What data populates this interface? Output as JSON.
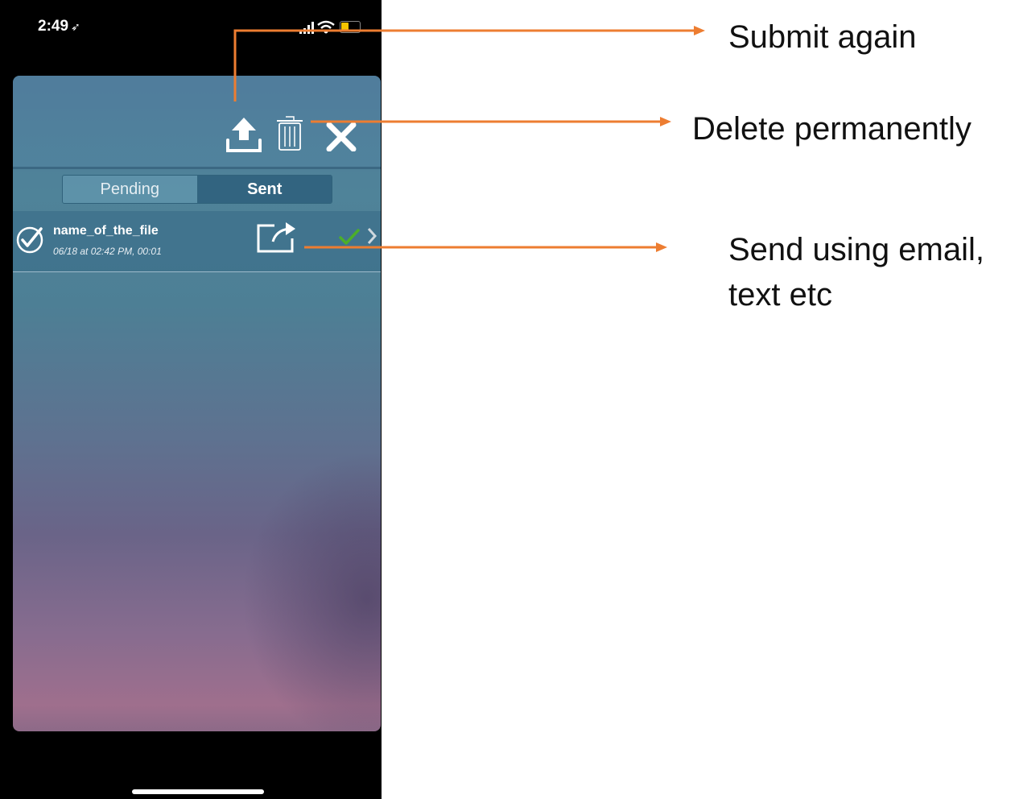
{
  "status_bar": {
    "time": "2:49",
    "location_glyph": "➶"
  },
  "toolbar": {
    "upload_icon": "upload-icon",
    "trash_icon": "trash-icon",
    "close_icon": "close-icon"
  },
  "tabs": [
    {
      "label": "Pending",
      "selected": false
    },
    {
      "label": "Sent",
      "selected": true
    }
  ],
  "files": [
    {
      "name": "name_of_the_file",
      "meta": "06/18 at 02:42 PM, 00:01",
      "status_color": "#4caf2a"
    }
  ],
  "annotations": {
    "submit": "Submit again",
    "delete": "Delete permanently",
    "send": "Send using email, text etc"
  },
  "colors": {
    "annotation_arrow": "#ed7d31"
  }
}
